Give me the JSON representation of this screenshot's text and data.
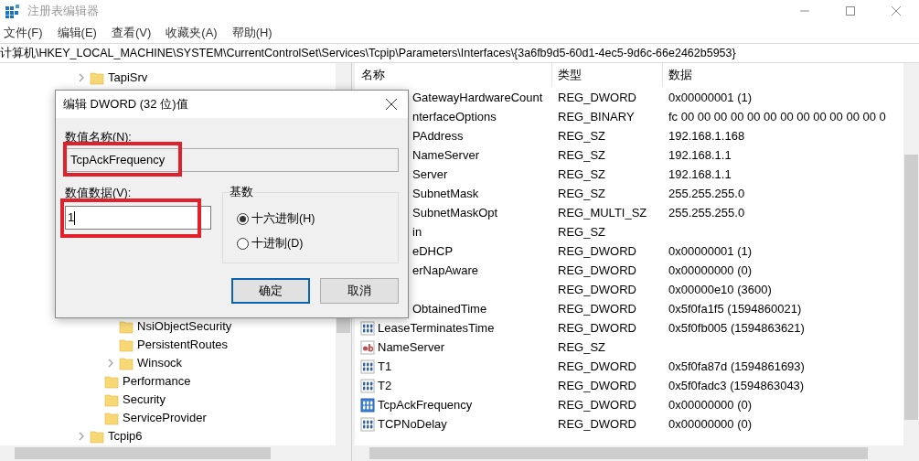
{
  "window": {
    "title": "注册表编辑器"
  },
  "menu": [
    "文件(F)",
    "编辑(E)",
    "查看(V)",
    "收藏夹(A)",
    "帮助(H)"
  ],
  "address": "计算机\\HKEY_LOCAL_MACHINE\\SYSTEM\\CurrentControlSet\\Services\\Tcpip\\Parameters\\Interfaces\\{3a6fb9d5-60d1-4ec5-9d6c-66e2462b5953}",
  "tree": [
    {
      "label": "TapiSrv",
      "expandable": true
    },
    {
      "children": [
        {
          "children": [
            {
              "label": "NsiObjectSecurity",
              "expandable": false
            },
            {
              "label": "PersistentRoutes",
              "expandable": false
            },
            {
              "label": "Winsock",
              "expandable": true
            }
          ]
        },
        {
          "label": "Performance",
          "expandable": false
        },
        {
          "label": "Security",
          "expandable": false
        },
        {
          "label": "ServiceProvider",
          "expandable": false
        }
      ]
    },
    {
      "label": "Tcpip6",
      "expandable": true
    }
  ],
  "list": {
    "columns": [
      "名称",
      "类型",
      "数据"
    ],
    "rows": [
      {
        "name": "GatewayHardwareCount",
        "type": "REG_DWORD",
        "data": "0x00000001 (1)"
      },
      {
        "name": "nterfaceOptions",
        "type": "REG_BINARY",
        "data": "fc 00 00 00 00 00 00 00 00 00 00 00 00 0"
      },
      {
        "name": "PAddress",
        "type": "REG_SZ",
        "data": "192.168.1.168"
      },
      {
        "name": "NameServer",
        "type": "REG_SZ",
        "data": "192.168.1.1"
      },
      {
        "name": "Server",
        "type": "REG_SZ",
        "data": "192.168.1.1"
      },
      {
        "name": "SubnetMask",
        "type": "REG_SZ",
        "data": "255.255.255.0"
      },
      {
        "name": "SubnetMaskOpt",
        "type": "REG_MULTI_SZ",
        "data": "255.255.255.0"
      },
      {
        "name": "in",
        "type": "REG_SZ"
      },
      {
        "name": "eDHCP",
        "type": "REG_DWORD",
        "data": "0x00000001 (1)"
      },
      {
        "name": "erNapAware",
        "type": "REG_DWORD",
        "data": "0x00000000 (0)"
      },
      {
        "type": "REG_DWORD",
        "data": "0x00000e10 (3600)"
      },
      {
        "name": "ObtainedTime",
        "type": "REG_DWORD",
        "data": "0x5f0fa1f5 (1594860021)"
      },
      {
        "name": "LeaseTerminatesTime",
        "kind": "binary",
        "type": "REG_DWORD",
        "data": "0x5f0fb005 (1594863621)"
      },
      {
        "name": "NameServer",
        "kind": "string",
        "type": "REG_SZ"
      },
      {
        "name": "T1",
        "kind": "binary",
        "type": "REG_DWORD",
        "data": "0x5f0fa87d (1594861693)"
      },
      {
        "name": "T2",
        "kind": "binary",
        "type": "REG_DWORD",
        "data": "0x5f0fadc3 (1594863043)"
      },
      {
        "name": "TcpAckFrequency",
        "kind": "binary",
        "selected": true,
        "type": "REG_DWORD",
        "data": "0x00000000 (0)"
      },
      {
        "name": "TCPNoDelay",
        "kind": "binary",
        "selected": false,
        "type": "REG_DWORD",
        "data": "0x00000000 (0)"
      }
    ]
  },
  "dialog": {
    "title": "编辑 DWORD (32 位)值",
    "name_label": "数值名称(N):",
    "name_value": "TcpAckFrequency",
    "data_label": "数值数据(V):",
    "data_value": "1",
    "base_label": "基数",
    "bases": [
      {
        "label": "十六进制(H)",
        "selected": true
      },
      {
        "label": "十进制(D)",
        "selected": false
      }
    ],
    "buttons": [
      {
        "label": "确定",
        "default": true
      },
      {
        "label": "取消",
        "default": false
      }
    ]
  }
}
